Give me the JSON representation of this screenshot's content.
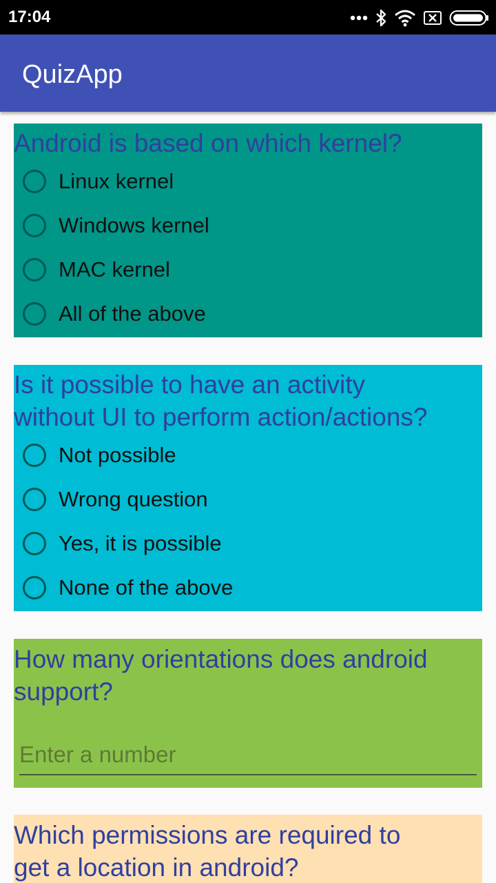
{
  "status_bar": {
    "time": "17:04",
    "icons": [
      "more-dots-icon",
      "bluetooth-icon",
      "wifi-icon",
      "sim-off-icon",
      "battery-icon"
    ]
  },
  "app_bar": {
    "title": "QuizApp",
    "color": "#3f51b5"
  },
  "questions": [
    {
      "text": "Android is based on which kernel?",
      "background": "#009688",
      "options": [
        "Linux kernel",
        "Windows kernel",
        "MAC kernel",
        "All of the above"
      ]
    },
    {
      "text_lines": [
        "Is it possible to have an activity",
        "without UI to perform action/actions?"
      ],
      "background": "#00bcd4",
      "options": [
        "Not possible",
        "Wrong question",
        "Yes, it is possible",
        "None of the above"
      ]
    },
    {
      "text_lines": [
        "How many orientations does android",
        "support?"
      ],
      "background": "#8bc34a",
      "input": {
        "value": "",
        "placeholder": "Enter a number"
      }
    },
    {
      "text_lines": [
        "Which permissions are required to",
        "get a location in android?"
      ],
      "background": "#ffe0b2"
    }
  ],
  "colors": {
    "question_text": "#303f9f",
    "radio_outline": "#005955"
  }
}
